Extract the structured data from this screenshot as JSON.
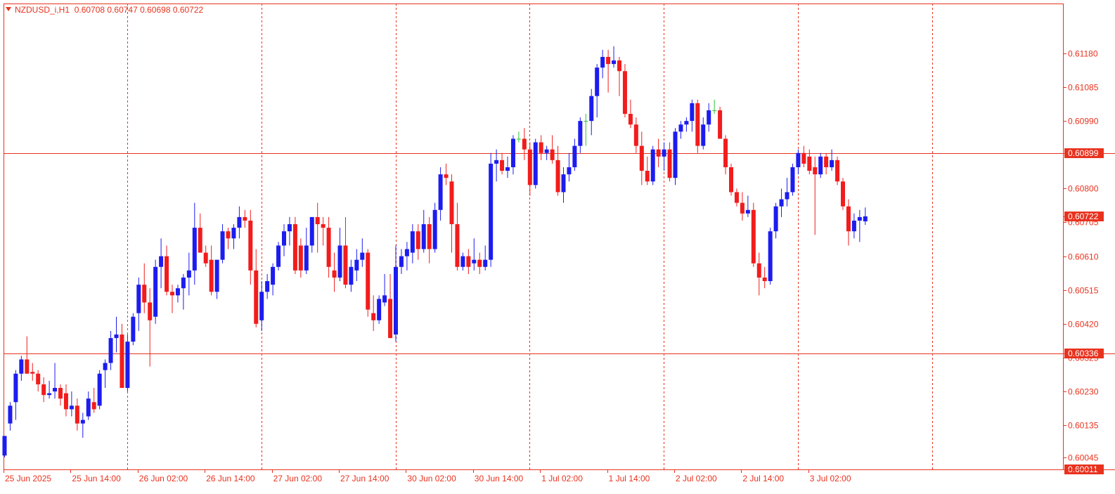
{
  "header": {
    "symbol": "NZDUSD_i,H1",
    "quote": "0.60708 0.60747 0.60698 0.60722"
  },
  "colors": {
    "background": "#ffffff",
    "frame": "#e8321e",
    "grid": "#e8321e",
    "bull": "#1c1cf0",
    "bear": "#f21c1c",
    "doji": "#2ec43a",
    "text": "#e8321e",
    "level_label_bg": "#e8321e",
    "level_label_text": "#ffffff"
  },
  "chart_data": {
    "type": "candlestick",
    "y_axis": {
      "ticks": [
        "0.61180",
        "0.61085",
        "0.60990",
        "0.60899",
        "0.60800",
        "0.60722",
        "0.60705",
        "0.60610",
        "0.60515",
        "0.60420",
        "0.60336",
        "0.60325",
        "0.60230",
        "0.60135",
        "0.60045",
        "0.60011"
      ],
      "ylim": [
        0.60011,
        0.6132
      ]
    },
    "x_axis": {
      "labels": [
        "25 Jun 2025",
        "25 Jun 14:00",
        "26 Jun 02:00",
        "26 Jun 14:00",
        "27 Jun 02:00",
        "27 Jun 14:00",
        "30 Jun 02:00",
        "30 Jun 14:00",
        "1 Jul 02:00",
        "1 Jul 14:00",
        "2 Jul 02:00",
        "2 Jul 14:00",
        "3 Jul 02:00"
      ],
      "separators": [
        "25 Jun 14:00",
        "26 Jun 14:00",
        "27 Jun 14:00",
        "30 Jun 14:00",
        "1 Jul 14:00",
        "2 Jul 14:00",
        "3 Jul 14:00"
      ]
    },
    "horizontal_levels": [
      {
        "price": 0.60899,
        "label": "0.60899"
      },
      {
        "price": 0.60336,
        "label": "0.60336"
      },
      {
        "price": 0.60011,
        "label": "0.60011"
      }
    ],
    "current_price": {
      "price": 0.60722,
      "label": "0.60722"
    },
    "candles": [
      {
        "o": 0.6005,
        "h": 0.60105,
        "l": 0.60045,
        "c": 0.60105
      },
      {
        "o": 0.6014,
        "h": 0.602,
        "l": 0.6012,
        "c": 0.6019
      },
      {
        "o": 0.602,
        "h": 0.6029,
        "l": 0.6015,
        "c": 0.6028
      },
      {
        "o": 0.6028,
        "h": 0.6033,
        "l": 0.6026,
        "c": 0.6032
      },
      {
        "o": 0.6032,
        "h": 0.60385,
        "l": 0.6028,
        "c": 0.6028
      },
      {
        "o": 0.60285,
        "h": 0.6031,
        "l": 0.6026,
        "c": 0.6028
      },
      {
        "o": 0.6028,
        "h": 0.6029,
        "l": 0.6023,
        "c": 0.6025
      },
      {
        "o": 0.6025,
        "h": 0.6027,
        "l": 0.602,
        "c": 0.6022
      },
      {
        "o": 0.6022,
        "h": 0.6026,
        "l": 0.6021,
        "c": 0.60225
      },
      {
        "o": 0.6023,
        "h": 0.6031,
        "l": 0.6021,
        "c": 0.6024
      },
      {
        "o": 0.6024,
        "h": 0.6025,
        "l": 0.6019,
        "c": 0.6021
      },
      {
        "o": 0.60225,
        "h": 0.6025,
        "l": 0.6016,
        "c": 0.6018
      },
      {
        "o": 0.6018,
        "h": 0.6023,
        "l": 0.6016,
        "c": 0.6019
      },
      {
        "o": 0.6019,
        "h": 0.6021,
        "l": 0.6012,
        "c": 0.6014
      },
      {
        "o": 0.6014,
        "h": 0.6017,
        "l": 0.601,
        "c": 0.6015
      },
      {
        "o": 0.6016,
        "h": 0.6023,
        "l": 0.6015,
        "c": 0.6021
      },
      {
        "o": 0.602,
        "h": 0.6024,
        "l": 0.6017,
        "c": 0.6018
      },
      {
        "o": 0.6019,
        "h": 0.6029,
        "l": 0.6018,
        "c": 0.6028
      },
      {
        "o": 0.6029,
        "h": 0.6032,
        "l": 0.6024,
        "c": 0.6031
      },
      {
        "o": 0.6031,
        "h": 0.604,
        "l": 0.6029,
        "c": 0.6038
      },
      {
        "o": 0.6038,
        "h": 0.6044,
        "l": 0.6034,
        "c": 0.6039
      },
      {
        "o": 0.6039,
        "h": 0.6042,
        "l": 0.6024,
        "c": 0.6024
      },
      {
        "o": 0.6024,
        "h": 0.6039,
        "l": 0.6023,
        "c": 0.6037
      },
      {
        "o": 0.6037,
        "h": 0.6045,
        "l": 0.6036,
        "c": 0.6044
      },
      {
        "o": 0.6045,
        "h": 0.6055,
        "l": 0.604,
        "c": 0.6053
      },
      {
        "o": 0.6053,
        "h": 0.6059,
        "l": 0.6045,
        "c": 0.6048
      },
      {
        "o": 0.6048,
        "h": 0.6052,
        "l": 0.603,
        "c": 0.6043
      },
      {
        "o": 0.6044,
        "h": 0.606,
        "l": 0.6042,
        "c": 0.6058
      },
      {
        "o": 0.6058,
        "h": 0.6066,
        "l": 0.6052,
        "c": 0.6061
      },
      {
        "o": 0.6061,
        "h": 0.6064,
        "l": 0.605,
        "c": 0.6051
      },
      {
        "o": 0.6051,
        "h": 0.6053,
        "l": 0.6045,
        "c": 0.605
      },
      {
        "o": 0.605,
        "h": 0.6053,
        "l": 0.6048,
        "c": 0.6052
      },
      {
        "o": 0.6052,
        "h": 0.6056,
        "l": 0.6046,
        "c": 0.6055
      },
      {
        "o": 0.6055,
        "h": 0.6062,
        "l": 0.605,
        "c": 0.6057
      },
      {
        "o": 0.6057,
        "h": 0.6076,
        "l": 0.6053,
        "c": 0.6069
      },
      {
        "o": 0.6069,
        "h": 0.6073,
        "l": 0.6062,
        "c": 0.6062
      },
      {
        "o": 0.6062,
        "h": 0.6064,
        "l": 0.6058,
        "c": 0.6059
      },
      {
        "o": 0.606,
        "h": 0.6064,
        "l": 0.605,
        "c": 0.6051
      },
      {
        "o": 0.6051,
        "h": 0.6055,
        "l": 0.6049,
        "c": 0.606
      },
      {
        "o": 0.606,
        "h": 0.607,
        "l": 0.6059,
        "c": 0.6068
      },
      {
        "o": 0.6068,
        "h": 0.6069,
        "l": 0.6063,
        "c": 0.6066
      },
      {
        "o": 0.6066,
        "h": 0.607,
        "l": 0.6063,
        "c": 0.6069
      },
      {
        "o": 0.6069,
        "h": 0.6075,
        "l": 0.6066,
        "c": 0.6072
      },
      {
        "o": 0.6072,
        "h": 0.6074,
        "l": 0.6069,
        "c": 0.6071
      },
      {
        "o": 0.6071,
        "h": 0.6074,
        "l": 0.6053,
        "c": 0.6057
      },
      {
        "o": 0.6057,
        "h": 0.6063,
        "l": 0.6041,
        "c": 0.6042
      },
      {
        "o": 0.6043,
        "h": 0.6054,
        "l": 0.604,
        "c": 0.6051
      },
      {
        "o": 0.6051,
        "h": 0.6056,
        "l": 0.6049,
        "c": 0.6054
      },
      {
        "o": 0.6053,
        "h": 0.6059,
        "l": 0.605,
        "c": 0.6058
      },
      {
        "o": 0.6058,
        "h": 0.6065,
        "l": 0.6057,
        "c": 0.6064
      },
      {
        "o": 0.6064,
        "h": 0.607,
        "l": 0.6061,
        "c": 0.6068
      },
      {
        "o": 0.6068,
        "h": 0.6072,
        "l": 0.6064,
        "c": 0.607
      },
      {
        "o": 0.607,
        "h": 0.6072,
        "l": 0.6056,
        "c": 0.6057
      },
      {
        "o": 0.6064,
        "h": 0.6066,
        "l": 0.6055,
        "c": 0.6057
      },
      {
        "o": 0.6057,
        "h": 0.6069,
        "l": 0.6056,
        "c": 0.6064
      },
      {
        "o": 0.6064,
        "h": 0.6072,
        "l": 0.6062,
        "c": 0.6072
      },
      {
        "o": 0.6072,
        "h": 0.6076,
        "l": 0.6062,
        "c": 0.607
      },
      {
        "o": 0.607,
        "h": 0.6072,
        "l": 0.6064,
        "c": 0.6069
      },
      {
        "o": 0.6069,
        "h": 0.6072,
        "l": 0.6055,
        "c": 0.6058
      },
      {
        "o": 0.6057,
        "h": 0.6062,
        "l": 0.6051,
        "c": 0.6055
      },
      {
        "o": 0.6055,
        "h": 0.6069,
        "l": 0.6054,
        "c": 0.6064
      },
      {
        "o": 0.6064,
        "h": 0.6072,
        "l": 0.6052,
        "c": 0.6053
      },
      {
        "o": 0.6053,
        "h": 0.606,
        "l": 0.6051,
        "c": 0.6058
      },
      {
        "o": 0.6057,
        "h": 0.6063,
        "l": 0.6054,
        "c": 0.606
      },
      {
        "o": 0.606,
        "h": 0.6066,
        "l": 0.6058,
        "c": 0.6062
      },
      {
        "o": 0.6062,
        "h": 0.6063,
        "l": 0.6044,
        "c": 0.6046
      },
      {
        "o": 0.6045,
        "h": 0.605,
        "l": 0.604,
        "c": 0.6043
      },
      {
        "o": 0.6043,
        "h": 0.605,
        "l": 0.6042,
        "c": 0.6049
      },
      {
        "o": 0.6048,
        "h": 0.6056,
        "l": 0.6047,
        "c": 0.605
      },
      {
        "o": 0.6049,
        "h": 0.6056,
        "l": 0.6038,
        "c": 0.6038
      },
      {
        "o": 0.6039,
        "h": 0.6064,
        "l": 0.6037,
        "c": 0.6058
      },
      {
        "o": 0.6058,
        "h": 0.6063,
        "l": 0.6056,
        "c": 0.6061
      },
      {
        "o": 0.6061,
        "h": 0.6065,
        "l": 0.6057,
        "c": 0.6063
      },
      {
        "o": 0.6062,
        "h": 0.607,
        "l": 0.6059,
        "c": 0.6068
      },
      {
        "o": 0.6068,
        "h": 0.607,
        "l": 0.606,
        "c": 0.6063
      },
      {
        "o": 0.6063,
        "h": 0.6074,
        "l": 0.6062,
        "c": 0.607
      },
      {
        "o": 0.607,
        "h": 0.6072,
        "l": 0.6059,
        "c": 0.6063
      },
      {
        "o": 0.6063,
        "h": 0.6076,
        "l": 0.6062,
        "c": 0.6074
      },
      {
        "o": 0.6074,
        "h": 0.6086,
        "l": 0.6071,
        "c": 0.6084
      },
      {
        "o": 0.6084,
        "h": 0.6087,
        "l": 0.6081,
        "c": 0.6083
      },
      {
        "o": 0.6082,
        "h": 0.6084,
        "l": 0.6062,
        "c": 0.607
      },
      {
        "o": 0.607,
        "h": 0.6076,
        "l": 0.6057,
        "c": 0.6058
      },
      {
        "o": 0.6058,
        "h": 0.6062,
        "l": 0.6057,
        "c": 0.6061
      },
      {
        "o": 0.6061,
        "h": 0.6063,
        "l": 0.6056,
        "c": 0.6058
      },
      {
        "o": 0.6059,
        "h": 0.6066,
        "l": 0.6057,
        "c": 0.606
      },
      {
        "o": 0.606,
        "h": 0.6062,
        "l": 0.6056,
        "c": 0.6058
      },
      {
        "o": 0.6058,
        "h": 0.6064,
        "l": 0.6057,
        "c": 0.606
      },
      {
        "o": 0.606,
        "h": 0.609,
        "l": 0.6058,
        "c": 0.6087
      },
      {
        "o": 0.6087,
        "h": 0.6091,
        "l": 0.6082,
        "c": 0.6088
      },
      {
        "o": 0.6088,
        "h": 0.609,
        "l": 0.6084,
        "c": 0.6085
      },
      {
        "o": 0.6085,
        "h": 0.6089,
        "l": 0.6083,
        "c": 0.6086
      },
      {
        "o": 0.6086,
        "h": 0.6095,
        "l": 0.6084,
        "c": 0.6094
      },
      {
        "o": 0.6094,
        "h": 0.6096,
        "l": 0.6093,
        "c": 0.6094
      },
      {
        "o": 0.6094,
        "h": 0.6097,
        "l": 0.6088,
        "c": 0.6091
      },
      {
        "o": 0.6091,
        "h": 0.6093,
        "l": 0.6078,
        "c": 0.6081
      },
      {
        "o": 0.6081,
        "h": 0.6094,
        "l": 0.608,
        "c": 0.6093
      },
      {
        "o": 0.6093,
        "h": 0.6095,
        "l": 0.6088,
        "c": 0.609
      },
      {
        "o": 0.609,
        "h": 0.6092,
        "l": 0.6088,
        "c": 0.6091
      },
      {
        "o": 0.6091,
        "h": 0.6095,
        "l": 0.6087,
        "c": 0.6088
      },
      {
        "o": 0.6088,
        "h": 0.6092,
        "l": 0.6078,
        "c": 0.6079
      },
      {
        "o": 0.6079,
        "h": 0.6086,
        "l": 0.6076,
        "c": 0.6084
      },
      {
        "o": 0.6084,
        "h": 0.609,
        "l": 0.6082,
        "c": 0.6086
      },
      {
        "o": 0.6086,
        "h": 0.6094,
        "l": 0.6085,
        "c": 0.6092
      },
      {
        "o": 0.6092,
        "h": 0.61,
        "l": 0.609,
        "c": 0.6099
      },
      {
        "o": 0.6099,
        "h": 0.6101,
        "l": 0.6092,
        "c": 0.6099
      },
      {
        "o": 0.6099,
        "h": 0.6108,
        "l": 0.6095,
        "c": 0.6106
      },
      {
        "o": 0.6106,
        "h": 0.6115,
        "l": 0.61,
        "c": 0.6114
      },
      {
        "o": 0.6114,
        "h": 0.6119,
        "l": 0.6111,
        "c": 0.6117
      },
      {
        "o": 0.6117,
        "h": 0.6119,
        "l": 0.6107,
        "c": 0.6115
      },
      {
        "o": 0.6115,
        "h": 0.612,
        "l": 0.6114,
        "c": 0.6116
      },
      {
        "o": 0.6116,
        "h": 0.6117,
        "l": 0.6106,
        "c": 0.6113
      },
      {
        "o": 0.6113,
        "h": 0.6115,
        "l": 0.61,
        "c": 0.6101
      },
      {
        "o": 0.6101,
        "h": 0.6105,
        "l": 0.6097,
        "c": 0.6098
      },
      {
        "o": 0.6098,
        "h": 0.61,
        "l": 0.609,
        "c": 0.6092
      },
      {
        "o": 0.6092,
        "h": 0.6096,
        "l": 0.6081,
        "c": 0.6085
      },
      {
        "o": 0.6085,
        "h": 0.6089,
        "l": 0.6081,
        "c": 0.6082
      },
      {
        "o": 0.6082,
        "h": 0.6092,
        "l": 0.6081,
        "c": 0.6091
      },
      {
        "o": 0.6091,
        "h": 0.6094,
        "l": 0.6086,
        "c": 0.6089
      },
      {
        "o": 0.6089,
        "h": 0.6093,
        "l": 0.6085,
        "c": 0.6091
      },
      {
        "o": 0.6091,
        "h": 0.6093,
        "l": 0.6082,
        "c": 0.6083
      },
      {
        "o": 0.6083,
        "h": 0.6097,
        "l": 0.6081,
        "c": 0.6096
      },
      {
        "o": 0.6096,
        "h": 0.6099,
        "l": 0.6094,
        "c": 0.6098
      },
      {
        "o": 0.6098,
        "h": 0.61,
        "l": 0.6096,
        "c": 0.6099
      },
      {
        "o": 0.6099,
        "h": 0.6105,
        "l": 0.6096,
        "c": 0.6104
      },
      {
        "o": 0.6104,
        "h": 0.6105,
        "l": 0.609,
        "c": 0.6092
      },
      {
        "o": 0.6092,
        "h": 0.61,
        "l": 0.6091,
        "c": 0.6098
      },
      {
        "o": 0.6098,
        "h": 0.6104,
        "l": 0.6096,
        "c": 0.6102
      },
      {
        "o": 0.6102,
        "h": 0.6105,
        "l": 0.6101,
        "c": 0.6102
      },
      {
        "o": 0.6102,
        "h": 0.6103,
        "l": 0.6094,
        "c": 0.6094
      },
      {
        "o": 0.6094,
        "h": 0.6095,
        "l": 0.6084,
        "c": 0.6086
      },
      {
        "o": 0.6086,
        "h": 0.6087,
        "l": 0.6078,
        "c": 0.6079
      },
      {
        "o": 0.6079,
        "h": 0.608,
        "l": 0.6075,
        "c": 0.6076
      },
      {
        "o": 0.6076,
        "h": 0.6079,
        "l": 0.6071,
        "c": 0.6073
      },
      {
        "o": 0.6073,
        "h": 0.6078,
        "l": 0.6072,
        "c": 0.6074
      },
      {
        "o": 0.6074,
        "h": 0.6076,
        "l": 0.6058,
        "c": 0.6059
      },
      {
        "o": 0.6059,
        "h": 0.6062,
        "l": 0.605,
        "c": 0.6055
      },
      {
        "o": 0.6055,
        "h": 0.6058,
        "l": 0.6052,
        "c": 0.6054
      },
      {
        "o": 0.6054,
        "h": 0.6069,
        "l": 0.6053,
        "c": 0.6068
      },
      {
        "o": 0.6068,
        "h": 0.6076,
        "l": 0.6066,
        "c": 0.6075
      },
      {
        "o": 0.6075,
        "h": 0.608,
        "l": 0.6072,
        "c": 0.6077
      },
      {
        "o": 0.6077,
        "h": 0.6083,
        "l": 0.6075,
        "c": 0.6079
      },
      {
        "o": 0.6079,
        "h": 0.6087,
        "l": 0.6078,
        "c": 0.6086
      },
      {
        "o": 0.6086,
        "h": 0.6091,
        "l": 0.6084,
        "c": 0.609
      },
      {
        "o": 0.609,
        "h": 0.6092,
        "l": 0.6086,
        "c": 0.6087
      },
      {
        "o": 0.6089,
        "h": 0.6091,
        "l": 0.6084,
        "c": 0.6085
      },
      {
        "o": 0.6086,
        "h": 0.6089,
        "l": 0.6067,
        "c": 0.6084
      },
      {
        "o": 0.6084,
        "h": 0.609,
        "l": 0.6083,
        "c": 0.6089
      },
      {
        "o": 0.6089,
        "h": 0.609,
        "l": 0.6084,
        "c": 0.6086
      },
      {
        "o": 0.6086,
        "h": 0.6091,
        "l": 0.6085,
        "c": 0.6088
      },
      {
        "o": 0.6088,
        "h": 0.6089,
        "l": 0.6081,
        "c": 0.6082
      },
      {
        "o": 0.6082,
        "h": 0.6083,
        "l": 0.6074,
        "c": 0.6075
      },
      {
        "o": 0.6075,
        "h": 0.6077,
        "l": 0.6064,
        "c": 0.6068
      },
      {
        "o": 0.6068,
        "h": 0.6073,
        "l": 0.6066,
        "c": 0.6071
      },
      {
        "o": 0.6071,
        "h": 0.6074,
        "l": 0.6065,
        "c": 0.6072
      },
      {
        "o": 0.60708,
        "h": 0.60747,
        "l": 0.60698,
        "c": 0.60722
      }
    ]
  }
}
